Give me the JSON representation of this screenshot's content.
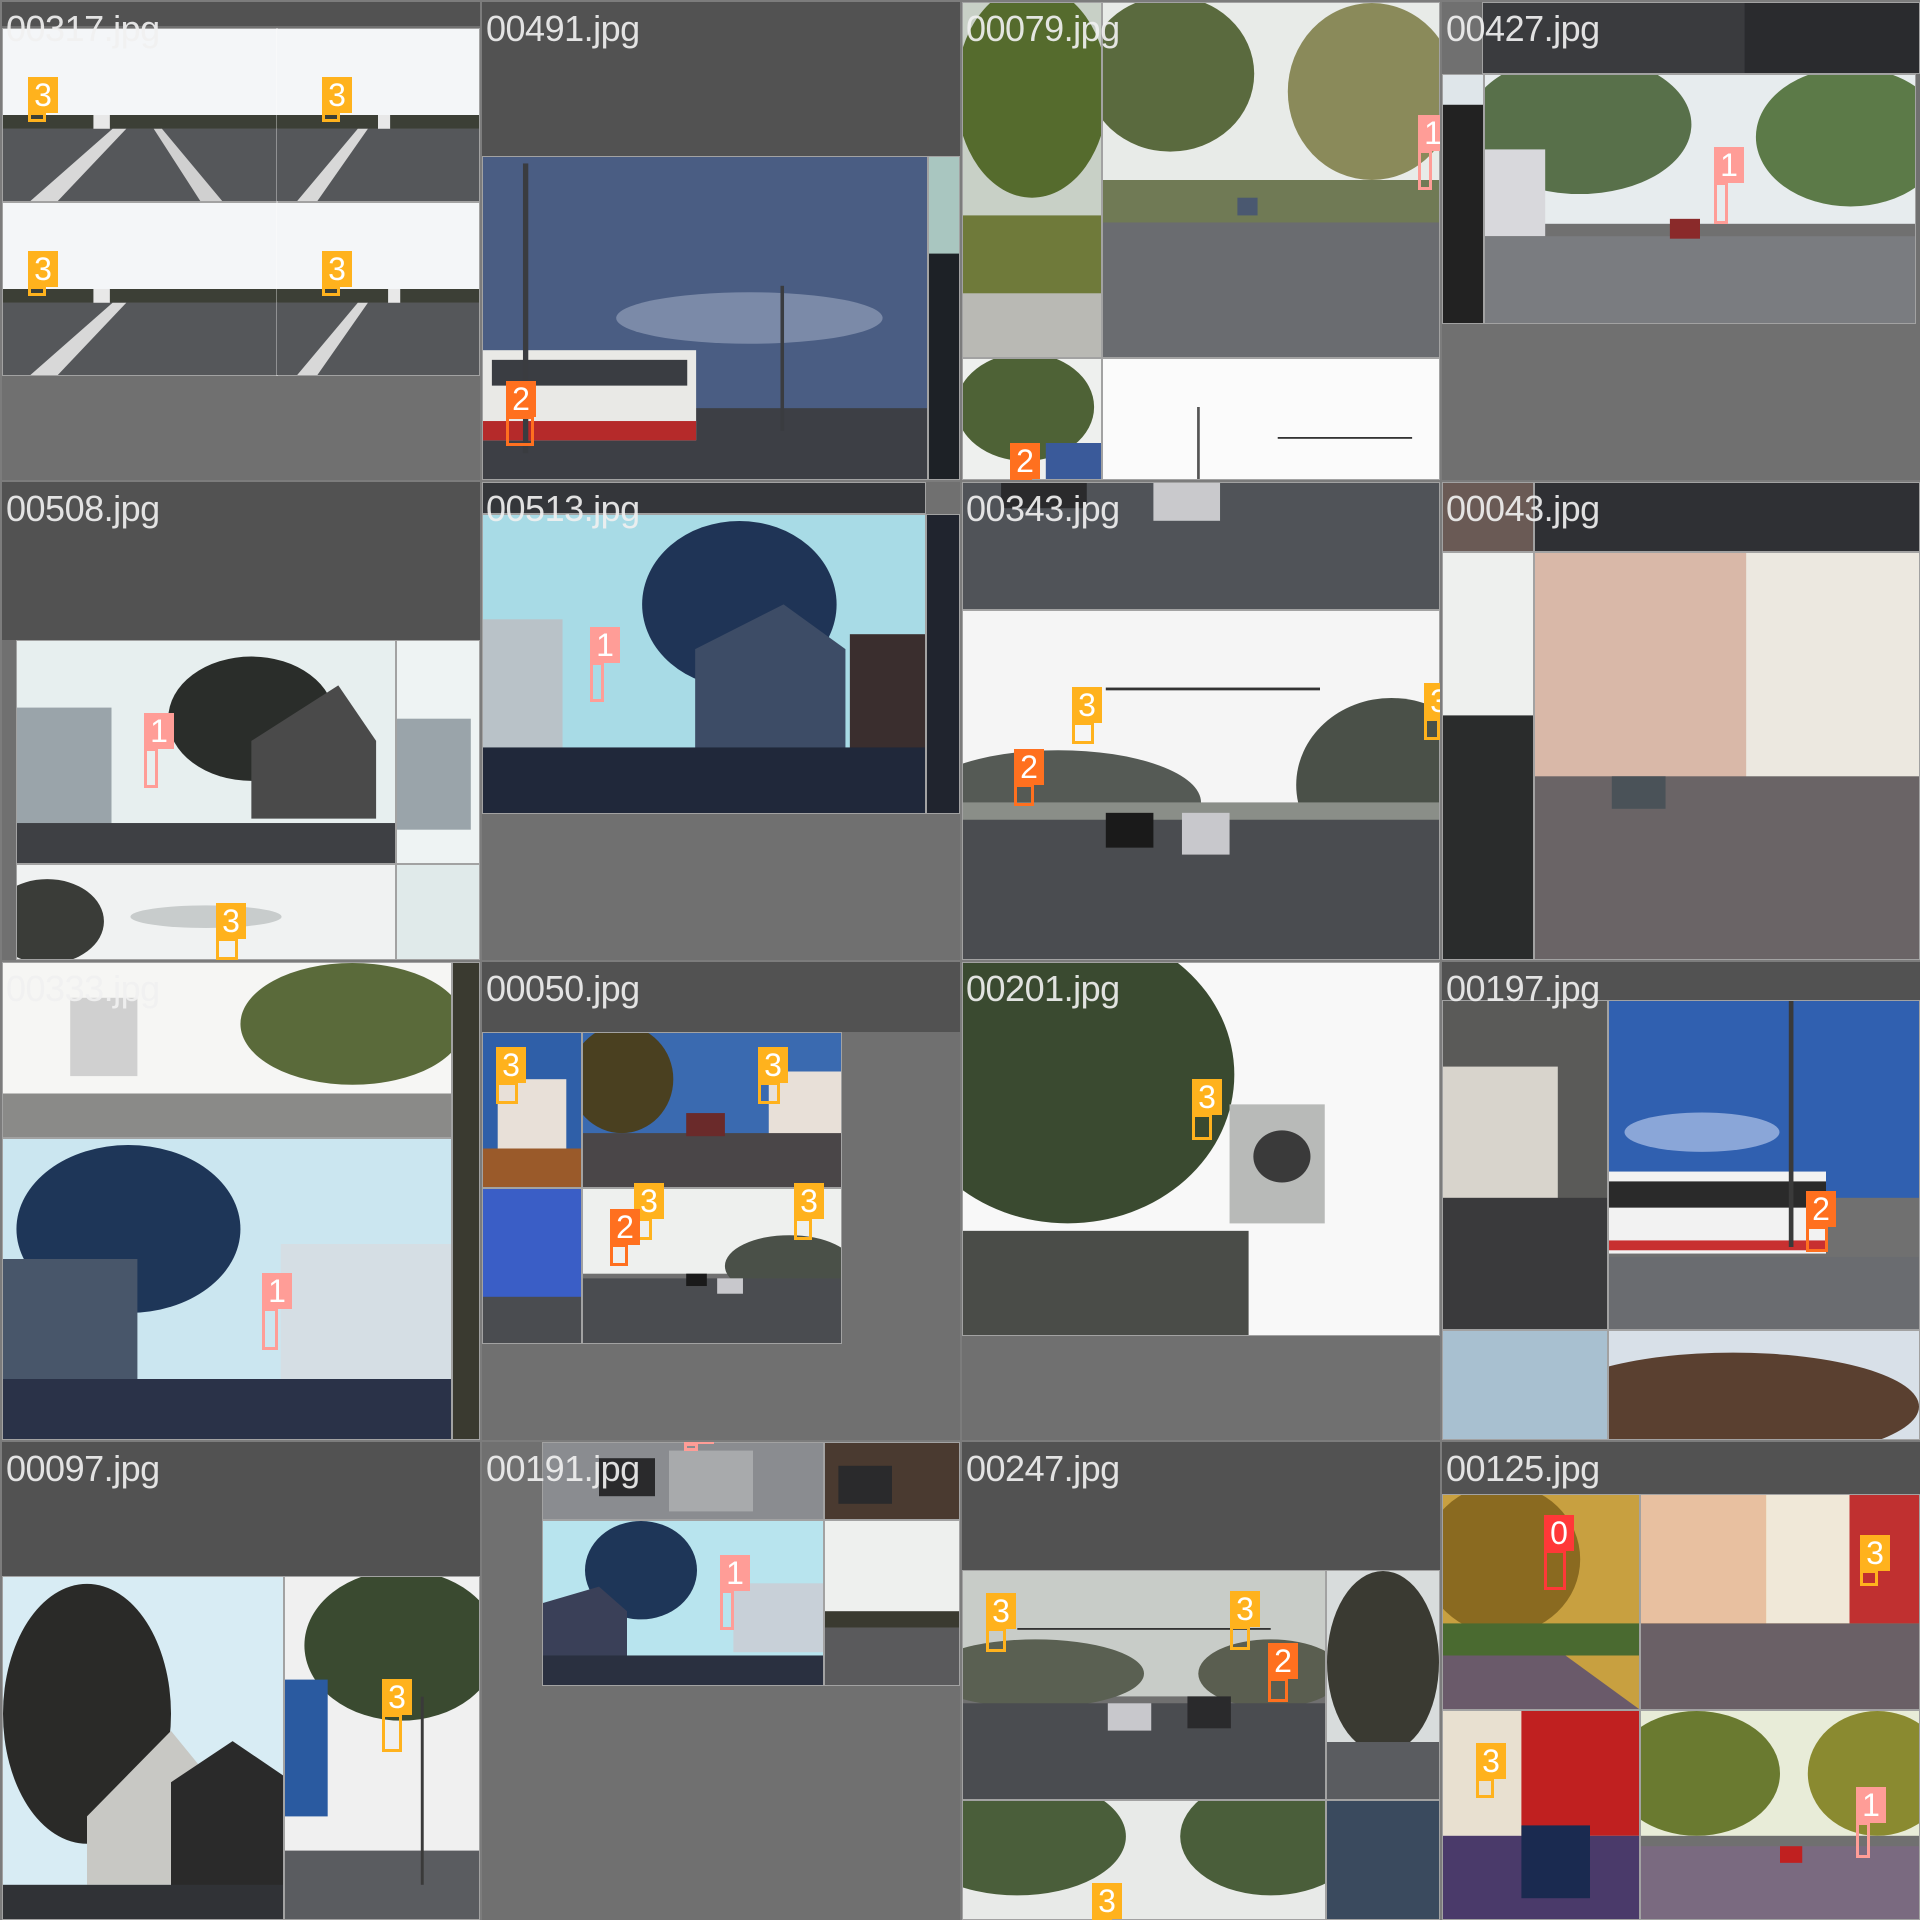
{
  "mosaic": {
    "class_colors": {
      "0": "#ff3838",
      "1": "#ff9d97",
      "2": "#ff701f",
      "3": "#ffb21d"
    },
    "tiles": [
      {
        "filename": "00317.jpg",
        "scene": "highway",
        "detections": [
          "3",
          "3",
          "3",
          "3"
        ]
      },
      {
        "filename": "00491.jpg",
        "scene": "bus-dusk",
        "detections": [
          "2"
        ]
      },
      {
        "filename": "00079.jpg",
        "scene": "tree-road",
        "detections": [
          "1",
          "2"
        ]
      },
      {
        "filename": "00427.jpg",
        "scene": "street-car",
        "detections": [
          "1"
        ]
      },
      {
        "filename": "00508.jpg",
        "scene": "tree-buildings",
        "detections": [
          "1",
          "3"
        ]
      },
      {
        "filename": "00513.jpg",
        "scene": "tree-buildings-blue",
        "detections": [
          "1"
        ]
      },
      {
        "filename": "00343.jpg",
        "scene": "intersection",
        "detections": [
          "3",
          "2",
          "3"
        ]
      },
      {
        "filename": "00043.jpg",
        "scene": "apartments",
        "detections": []
      },
      {
        "filename": "00333.jpg",
        "scene": "tree-buildings-bright",
        "detections": [
          "1"
        ]
      },
      {
        "filename": "00050.jpg",
        "scene": "collage",
        "detections": [
          "3",
          "3",
          "3",
          "2",
          "3"
        ]
      },
      {
        "filename": "00201.jpg",
        "scene": "suv-bright",
        "detections": [
          "3"
        ]
      },
      {
        "filename": "00197.jpg",
        "scene": "bus-day",
        "detections": [
          "2"
        ]
      },
      {
        "filename": "00097.jpg",
        "scene": "tree-houses",
        "detections": [
          "3"
        ]
      },
      {
        "filename": "00191.jpg",
        "scene": "street-traffic",
        "detections": [
          "1",
          "1"
        ]
      },
      {
        "filename": "00247.jpg",
        "scene": "intersection-fog",
        "detections": [
          "3",
          "3",
          "2",
          "3"
        ]
      },
      {
        "filename": "00125.jpg",
        "scene": "autumn-streets",
        "detections": [
          "0",
          "3",
          "3",
          "1"
        ]
      }
    ]
  }
}
